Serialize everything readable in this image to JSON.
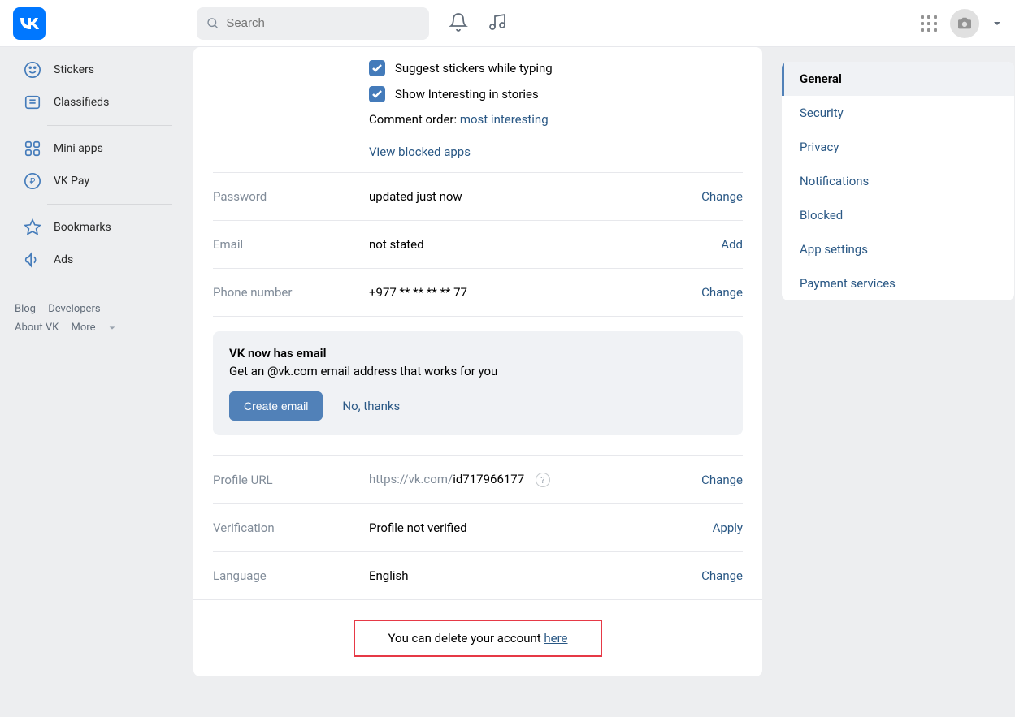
{
  "header": {
    "search_placeholder": "Search"
  },
  "sidebar": {
    "items": [
      {
        "label": "Stickers"
      },
      {
        "label": "Classifieds"
      },
      {
        "label": "Mini apps"
      },
      {
        "label": "VK Pay"
      },
      {
        "label": "Bookmarks"
      },
      {
        "label": "Ads"
      }
    ],
    "footer": {
      "blog": "Blog",
      "developers": "Developers",
      "about": "About VK",
      "more": "More"
    }
  },
  "main": {
    "suggest_stickers": "Suggest stickers while typing",
    "show_interesting": "Show Interesting in stories",
    "comment_order_label": "Comment order: ",
    "comment_order_value": "most interesting",
    "view_blocked": "View blocked apps",
    "password": {
      "label": "Password",
      "value": "updated just now",
      "action": "Change"
    },
    "email": {
      "label": "Email",
      "value": "not stated",
      "action": "Add"
    },
    "phone": {
      "label": "Phone number",
      "value": "+977 ** ** ** ** 77",
      "action": "Change"
    },
    "promo": {
      "title": "VK now has email",
      "desc": "Get an @vk.com email address that works for you",
      "create": "Create email",
      "no_thanks": "No, thanks"
    },
    "profile_url": {
      "label": "Profile URL",
      "prefix": "https://vk.com/",
      "id": "id717966177",
      "action": "Change"
    },
    "verification": {
      "label": "Verification",
      "value": "Profile not verified",
      "action": "Apply"
    },
    "language": {
      "label": "Language",
      "value": "English",
      "action": "Change"
    },
    "delete_text": "You can delete your account ",
    "delete_link": "here"
  },
  "settings_nav": [
    {
      "label": "General",
      "active": true
    },
    {
      "label": "Security"
    },
    {
      "label": "Privacy"
    },
    {
      "label": "Notifications"
    },
    {
      "label": "Blocked"
    },
    {
      "label": "App settings"
    },
    {
      "label": "Payment services"
    }
  ]
}
